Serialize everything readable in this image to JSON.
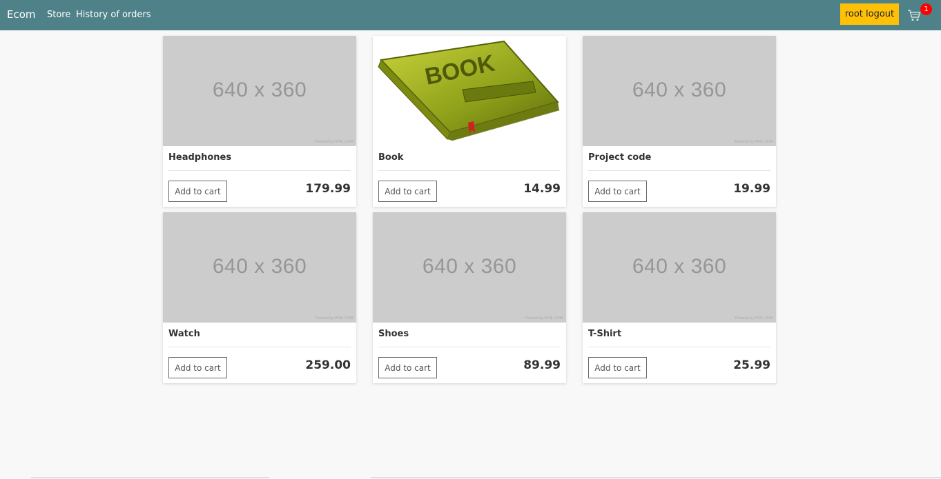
{
  "navbar": {
    "brand": "Ecom",
    "links": [
      "Store",
      "History of orders"
    ],
    "logout_label": "root logout",
    "cart_count": "1",
    "accent_color": "#4e8288",
    "logout_color": "#ffc107",
    "badge_color": "#ff0000",
    "cart_icon": "shopping-cart-icon"
  },
  "products": [
    {
      "name": "Headphones",
      "price": "179.99",
      "image_text": "640 x 360",
      "powered": "Powered by HTML.COM",
      "button": "Add to cart"
    },
    {
      "name": "Book",
      "price": "14.99",
      "image_text": "BOOK",
      "button": "Add to cart"
    },
    {
      "name": "Project code",
      "price": "19.99",
      "image_text": "640 x 360",
      "powered": "Powered by HTML.COM",
      "button": "Add to cart"
    },
    {
      "name": "Watch",
      "price": "259.00",
      "image_text": "640 x 360",
      "powered": "Powered by HTML.COM",
      "button": "Add to cart"
    },
    {
      "name": "Shoes",
      "price": "89.99",
      "image_text": "640 x 360",
      "powered": "Powered by HTML.COM",
      "button": "Add to cart"
    },
    {
      "name": "T-Shirt",
      "price": "25.99",
      "image_text": "640 x 360",
      "powered": "Powered by HTML.COM",
      "button": "Add to cart"
    }
  ]
}
